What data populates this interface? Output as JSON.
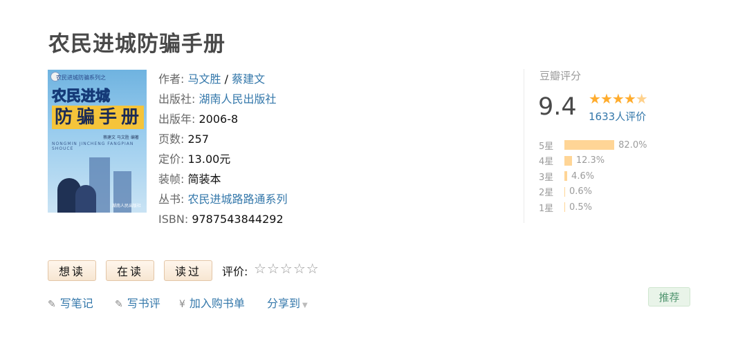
{
  "title": "农民进城防骗手册",
  "cover": {
    "series_text": "农民进城防骗系列之",
    "title_line1": "农民进城",
    "title_line2": "防骗手册",
    "pinyin": "NONGMIN JINCHENG FANGPIAN SHOUCE",
    "authors_text": "蔡建文  马文胜  编著",
    "publisher_text": "湖南人民出版社"
  },
  "info": {
    "author_label": "作者:",
    "author1": "马文胜",
    "author_sep": " / ",
    "author2": "蔡建文",
    "publisher_label": "出版社:",
    "publisher": "湖南人民出版社",
    "year_label": "出版年:",
    "year": "2006-8",
    "pages_label": "页数:",
    "pages": "257",
    "price_label": "定价:",
    "price": "13.00元",
    "binding_label": "装帧:",
    "binding": "简装本",
    "series_label": "丛书:",
    "series": "农民进城路路通系列",
    "isbn_label": "ISBN:",
    "isbn": "9787543844292"
  },
  "rating": {
    "label": "豆瓣评分",
    "score": "9.4",
    "stars_value": 4.5,
    "count": "1633人评价",
    "distribution": [
      {
        "label": "5星",
        "percent": "82.0%",
        "value": 82.0
      },
      {
        "label": "4星",
        "percent": "12.3%",
        "value": 12.3
      },
      {
        "label": "3星",
        "percent": "4.6%",
        "value": 4.6
      },
      {
        "label": "2星",
        "percent": "0.6%",
        "value": 0.6
      },
      {
        "label": "1星",
        "percent": "0.5%",
        "value": 0.5
      }
    ]
  },
  "actions": {
    "want": "想读",
    "reading": "在读",
    "read": "读过",
    "rate_label": "评价:",
    "write_note": "写笔记",
    "write_review": "写书评",
    "add_booklist": "加入购书单",
    "share": "分享到",
    "recommend": "推荐"
  },
  "colors": {
    "link": "#3377aa",
    "star": "#ffac2d",
    "bar": "#ffd596",
    "recommend_text": "#4f946e"
  }
}
